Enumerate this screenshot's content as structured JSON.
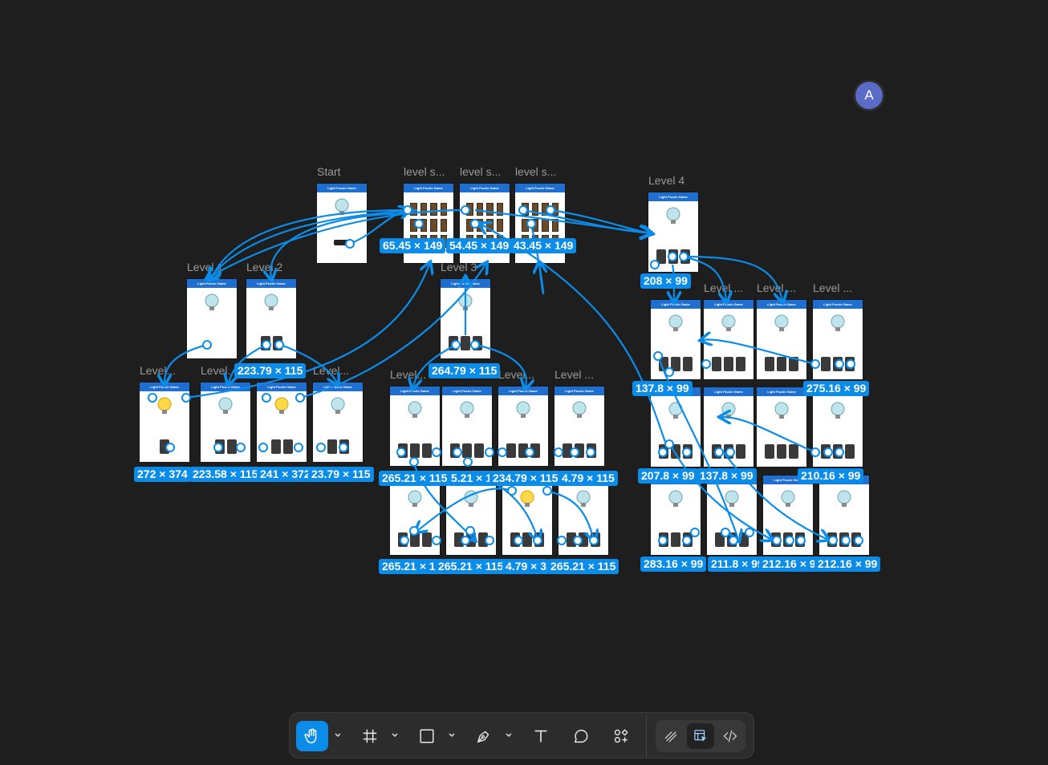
{
  "frames": {
    "start": "Start",
    "level_select_1": "level s...",
    "level_select_2": "level s...",
    "level_select_3": "level s...",
    "level4": "Level 4",
    "level1": "Level 1",
    "level2": "Level 2",
    "level3": "Level 3",
    "lv_a": "Level...",
    "lv_b": "Level...",
    "lv_c": "Level...",
    "lv_d": "Level...",
    "lv_e": "Level...",
    "lv_f": "Level ...",
    "lv_g": "Level ...",
    "lv_h": "Level ...",
    "lv_i": "Level ...",
    "header_text": "Light Puzzle Game",
    "start_button": "START"
  },
  "dimensions": {
    "d1": "65.45 × 149",
    "d2": "54.45 × 149",
    "d3": "43.45 × 149",
    "d4": "208 × 99",
    "d5": "223.79 × 115",
    "d6": "264.79 × 115",
    "d7": "137.8 × 99",
    "d8": "275.16 × 99",
    "d9": "272 × 374",
    "d10": "223.58 × 115",
    "d11": "241 × 372",
    "d12": "23.79 × 115",
    "d13": "265.21 × 115",
    "d14": "5.21 × 115",
    "d15": "234.79 × 115",
    "d16": "4.79 × 115",
    "d17": "207.8 × 99",
    "d18": "137.8 × 99",
    "d19": "210.16 × 99",
    "d20": "265.21 × 1",
    "d21": "265.21 × 115",
    "d22": "4.79 × 3",
    "d23": "265.21 × 115",
    "d24": "283.16 × 99",
    "d25": "211.8 × 99",
    "d26": "212.16 × 9",
    "d27": "212.16 × 99"
  },
  "avatar": {
    "initial": "A"
  },
  "toolbar": {
    "tools": [
      "hand-tool",
      "frame-tool",
      "shape-tool",
      "pen-tool",
      "text-tool",
      "comment-tool",
      "actions-tool"
    ],
    "modes": [
      "draw-mode",
      "design-mode",
      "dev-mode"
    ],
    "active_tool": "hand-tool",
    "active_mode": "design-mode",
    "accent": "#0c8ce9"
  },
  "colors": {
    "canvas": "#1e1e1e",
    "accent": "#0c8ce9",
    "frame_header": "#1e6fd0"
  }
}
